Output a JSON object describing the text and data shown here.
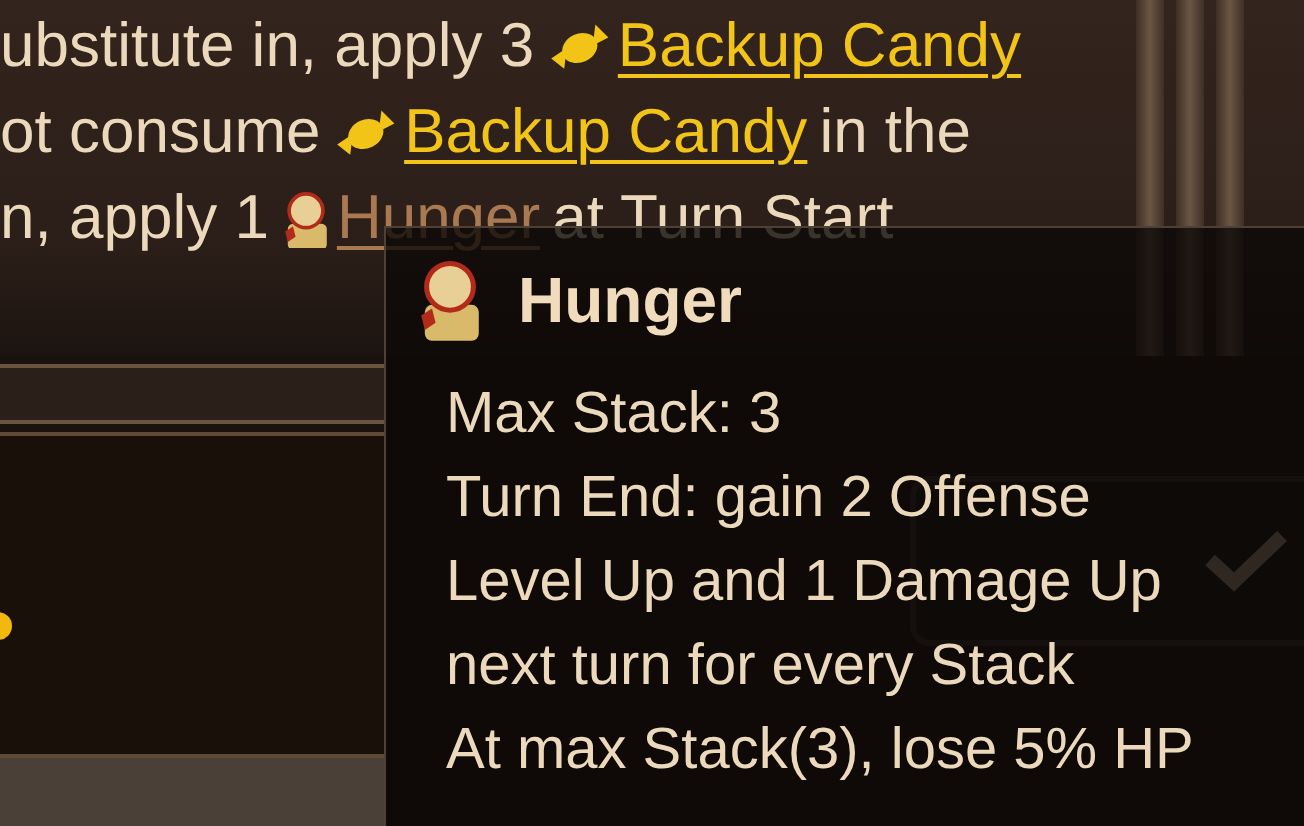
{
  "description_lines": [
    {
      "segments": [
        {
          "kind": "text",
          "text": "ubstitute in, apply 3"
        },
        {
          "kind": "candy_link",
          "color": "#f2c417",
          "text": "Backup Candy"
        }
      ]
    },
    {
      "segments": [
        {
          "kind": "text",
          "text": "ot consume"
        },
        {
          "kind": "candy_link",
          "color": "#f2c417",
          "text": "Backup Candy"
        },
        {
          "kind": "text",
          "text": "in the"
        }
      ]
    },
    {
      "segments": [
        {
          "kind": "text",
          "text": "n, apply 1"
        },
        {
          "kind": "status_link",
          "color": "#a97a52",
          "text": "Hunger"
        },
        {
          "kind": "text",
          "text": "at Turn Start"
        }
      ]
    }
  ],
  "tooltip": {
    "title": "Hunger",
    "lines": [
      "Max Stack: 3",
      "Turn End: gain 2 Offense",
      "Level Up and 1 Damage Up",
      "next turn for every Stack",
      "At max Stack(3), lose 5% HP"
    ]
  }
}
